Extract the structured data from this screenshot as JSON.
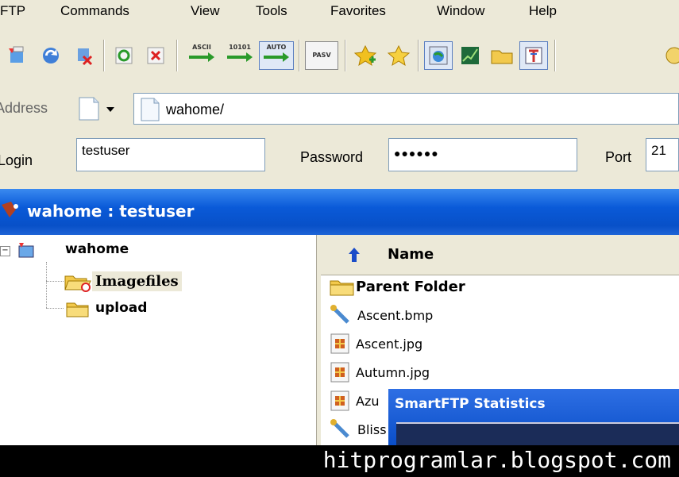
{
  "menu": [
    "FTP",
    "Commands",
    "View",
    "Tools",
    "Favorites",
    "Window",
    "Help"
  ],
  "toolbar": {
    "ascii_label": "ASCII",
    "binary_label": "10101",
    "auto_label": "AUTO",
    "pasv_label": "PASV"
  },
  "address": {
    "label": "Address",
    "value": "wahome/"
  },
  "login": {
    "login_label": "Login",
    "login_value": "testuser",
    "password_label": "Password",
    "password_value": "●●●●●●",
    "port_label": "Port",
    "port_value": "21"
  },
  "panel": {
    "title": "wahome : testuser"
  },
  "tree": {
    "root": "wahome",
    "children": [
      "Imagefiles",
      "upload"
    ]
  },
  "list": {
    "header": "Name",
    "items": [
      "Parent Folder",
      "Ascent.bmp",
      "Ascent.jpg",
      "Autumn.jpg",
      "Azu",
      "Bliss"
    ]
  },
  "stats_window": {
    "title": "SmartFTP Statistics"
  },
  "watermark": "hitprogramlar.blogspot.com"
}
